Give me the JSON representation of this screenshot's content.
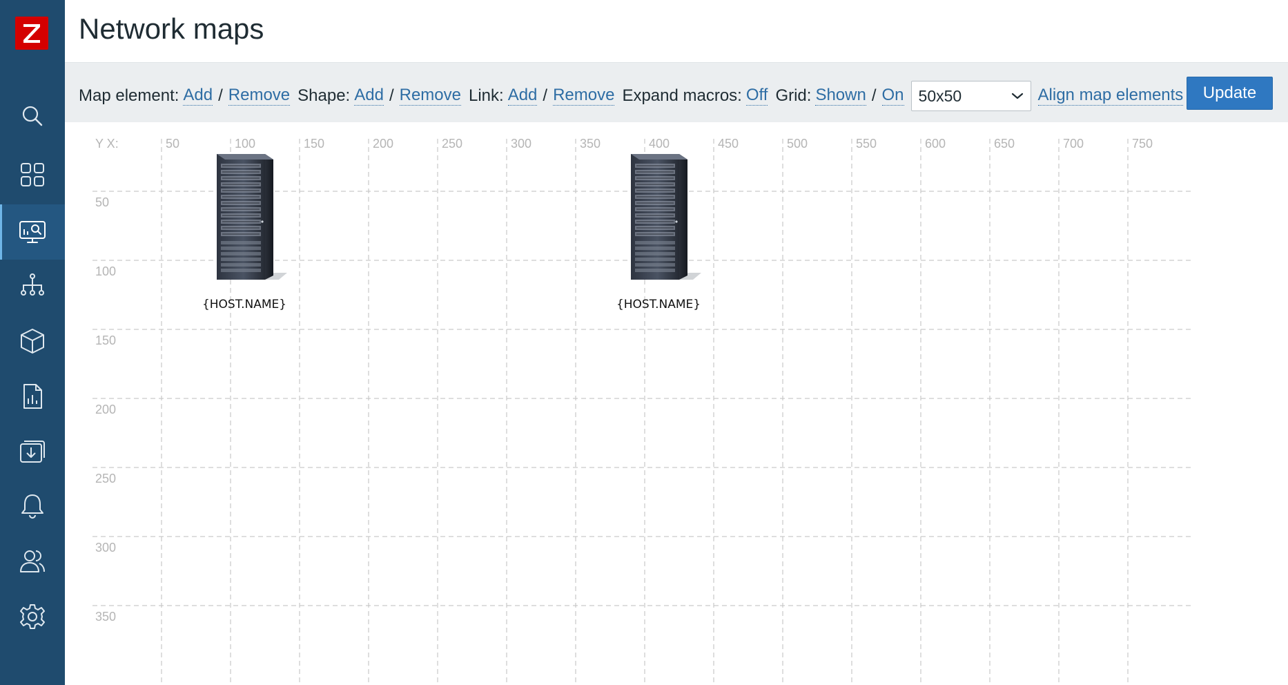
{
  "app": {
    "logo_letter": "Z",
    "brand_color": "#d40000",
    "sidebar_color": "#1f4b6e"
  },
  "sidebar": {
    "items": [
      {
        "icon": "search-icon"
      },
      {
        "icon": "dashboards-icon"
      },
      {
        "icon": "monitoring-icon",
        "active": true
      },
      {
        "icon": "services-icon"
      },
      {
        "icon": "inventory-icon"
      },
      {
        "icon": "reports-icon"
      },
      {
        "icon": "data-collection-icon"
      },
      {
        "icon": "alerts-icon"
      },
      {
        "icon": "users-icon"
      },
      {
        "icon": "administration-icon"
      }
    ]
  },
  "header": {
    "title": "Network maps"
  },
  "toolbar": {
    "map_element_label": "Map element:",
    "shape_label": "Shape:",
    "link_label": "Link:",
    "expand_macros_label": "Expand macros:",
    "grid_label": "Grid:",
    "add": "Add",
    "remove": "Remove",
    "slash": "/",
    "expand_macros_value": "Off",
    "grid_shown": "Shown",
    "grid_on": "On",
    "grid_size": "50x50",
    "align_label": "Align map elements",
    "update_label": "Update",
    "accent_color": "#2e6da4",
    "button_color": "#2f78c1"
  },
  "map": {
    "axis_caption": "Y X:",
    "x_ticks": [
      "50",
      "100",
      "150",
      "200",
      "250",
      "300",
      "350",
      "400",
      "450",
      "500",
      "550",
      "600",
      "650",
      "700",
      "750"
    ],
    "y_ticks": [
      "50",
      "100",
      "150",
      "200",
      "250",
      "300",
      "350"
    ],
    "grid_color": "#c9c9c9",
    "hosts": [
      {
        "label": "{HOST.NAME}",
        "icon": "server-rack-icon",
        "x": 75,
        "y": 20
      },
      {
        "label": "{HOST.NAME}",
        "icon": "server-rack-icon",
        "x": 375,
        "y": 20
      }
    ]
  }
}
